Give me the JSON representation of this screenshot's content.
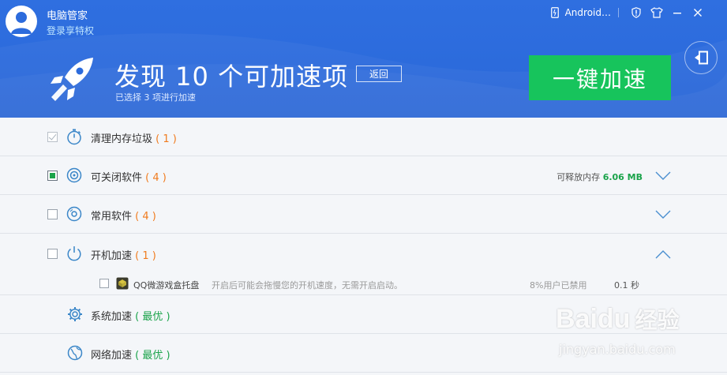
{
  "app": {
    "name": "电脑管家",
    "vip_link": "登录享特权"
  },
  "topbar": {
    "android_label": "Android…"
  },
  "hero": {
    "title": "发现 10 个可加速项",
    "back_label": "返回",
    "subtitle": "已选择 3 项进行加速",
    "accelerate_label": "一键加速"
  },
  "items": [
    {
      "label": "清理内存垃圾",
      "count": "( 1 )",
      "checkbox": "checked-disabled"
    },
    {
      "label": "可关闭软件",
      "count": "( 4 )",
      "checkbox": "partial",
      "mem_prefix": "可释放内存",
      "mem_value": "6.06 MB"
    },
    {
      "label": "常用软件",
      "count": "( 4 )",
      "checkbox": "unchecked"
    },
    {
      "label": "开机加速",
      "count": "( 1 )",
      "checkbox": "unchecked",
      "expanded": true
    },
    {
      "label": "系统加速",
      "status": "( 最优 )"
    },
    {
      "label": "网络加速",
      "status": "( 最优 )"
    }
  ],
  "startup_sub": {
    "name": "QQ微游戏盒托盘",
    "desc": "开启后可能会拖慢您的开机速度，无需开启启动。",
    "users": "8%用户已禁用",
    "time": "0.1 秒"
  },
  "watermark": {
    "brand": "Baidu",
    "jingyan": "经验",
    "url": "jingyan.baidu.com"
  },
  "colors": {
    "header_blue": "#2c6bdc",
    "accent_green": "#17c45c",
    "count_orange": "#f07b1e",
    "best_green": "#1aa34a"
  }
}
